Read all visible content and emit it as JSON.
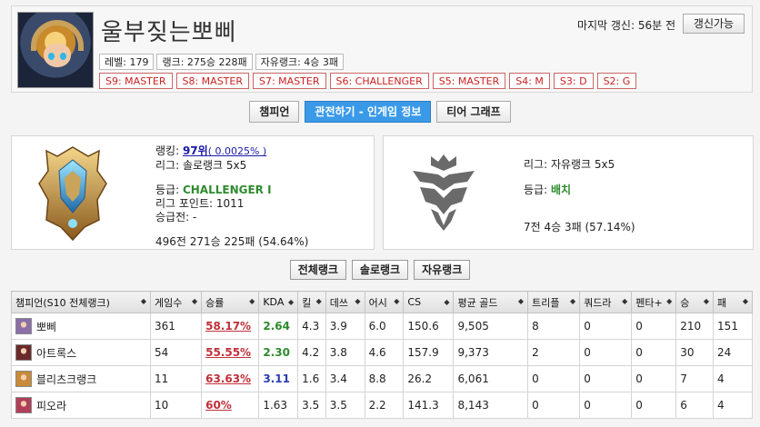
{
  "profile": {
    "name": "울부짖는뽀삐",
    "level": "레벨: 179",
    "solo_record": "랭크: 275승 228패",
    "flex_record": "자유랭크: 4승 3패",
    "seasons": [
      "S9: MASTER",
      "S8: MASTER",
      "S7: MASTER",
      "S6: CHALLENGER",
      "S5: MASTER",
      "S4: M",
      "S3: D",
      "S2: G"
    ],
    "last_updated": "마지막 갱신: 56분 전",
    "refresh_label": "갱신가능"
  },
  "tabs": [
    {
      "label": "챔피언",
      "active": false
    },
    {
      "label": "관전하기 - 인게임 정보",
      "active": true
    },
    {
      "label": "티어 그래프",
      "active": false
    }
  ],
  "solo": {
    "ranking_label": "랭킹:",
    "ranking_value": "97위",
    "ranking_pct": "( 0.0025% )",
    "league": "리그: 솔로랭크 5x5",
    "tier_label": "등급:",
    "tier_value": "CHALLENGER I",
    "lp": "리그 포인트: 1011",
    "promo": "승급전: -",
    "record": "496전 271승 225패 (54.64%)"
  },
  "flex": {
    "league": "리그: 자유랭크 5x5",
    "tier_label": "등급:",
    "tier_value": "배치",
    "record": "7전 4승 3패 (57.14%)"
  },
  "subtabs": [
    "전체랭크",
    "솔로랭크",
    "자유랭크"
  ],
  "table": {
    "headers": [
      "챔피언(S10 전체랭크)",
      "게임수",
      "승률",
      "KDA",
      "킬",
      "데쓰",
      "어시",
      "CS",
      "평균 골드",
      "트리플",
      "쿼드라",
      "펜타+",
      "승",
      "패"
    ],
    "rows": [
      {
        "champ": "뽀삐",
        "games": "361",
        "winrate": "58.17%",
        "kda": "2.64",
        "kda_color": "green",
        "kills": "4.3",
        "deaths": "3.9",
        "assists": "6.0",
        "cs": "150.6",
        "gold": "9,505",
        "triple": "8",
        "quadra": "0",
        "penta": "0",
        "wins": "210",
        "losses": "151",
        "icon_color": "#8a6fa8"
      },
      {
        "champ": "아트록스",
        "games": "54",
        "winrate": "55.55%",
        "kda": "2.30",
        "kda_color": "green",
        "kills": "4.2",
        "deaths": "3.8",
        "assists": "4.6",
        "cs": "157.9",
        "gold": "9,373",
        "triple": "2",
        "quadra": "0",
        "penta": "0",
        "wins": "30",
        "losses": "24",
        "icon_color": "#6a2a2a"
      },
      {
        "champ": "블리츠크랭크",
        "games": "11",
        "winrate": "63.63%",
        "kda": "3.11",
        "kda_color": "blue",
        "kills": "1.6",
        "deaths": "3.4",
        "assists": "8.8",
        "cs": "26.2",
        "gold": "6,061",
        "triple": "0",
        "quadra": "0",
        "penta": "0",
        "wins": "7",
        "losses": "4",
        "icon_color": "#c98a3a"
      },
      {
        "champ": "피오라",
        "games": "10",
        "winrate": "60%",
        "kda": "1.63",
        "kda_color": "plain",
        "kills": "3.5",
        "deaths": "3.5",
        "assists": "2.2",
        "cs": "141.3",
        "gold": "8,143",
        "triple": "0",
        "quadra": "0",
        "penta": "0",
        "wins": "6",
        "losses": "4",
        "icon_color": "#b0405a"
      }
    ]
  }
}
